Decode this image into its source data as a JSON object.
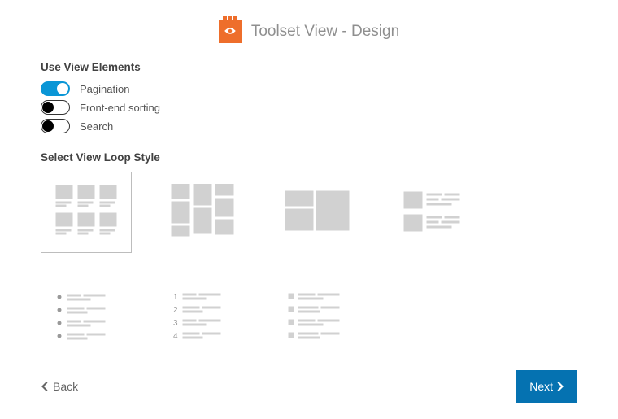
{
  "page_title": "Toolset View - Design",
  "elements_section_title": "Use View Elements",
  "options": [
    {
      "label": "Pagination",
      "on": true
    },
    {
      "label": "Front-end sorting",
      "on": false
    },
    {
      "label": "Search",
      "on": false
    }
  ],
  "loop_section_title": "Select View Loop Style",
  "tiles": [
    {
      "name": "grid-captions",
      "selected": true
    },
    {
      "name": "masonry",
      "selected": false
    },
    {
      "name": "collage",
      "selected": false
    },
    {
      "name": "thumb-list",
      "selected": false
    },
    {
      "name": "bulleted-list",
      "selected": false
    },
    {
      "name": "ordered-list",
      "selected": false
    },
    {
      "name": "text-rows",
      "selected": false
    }
  ],
  "ordered_numbers": [
    "1",
    "2",
    "3",
    "4"
  ],
  "back_label": "Back",
  "next_label": "Next"
}
